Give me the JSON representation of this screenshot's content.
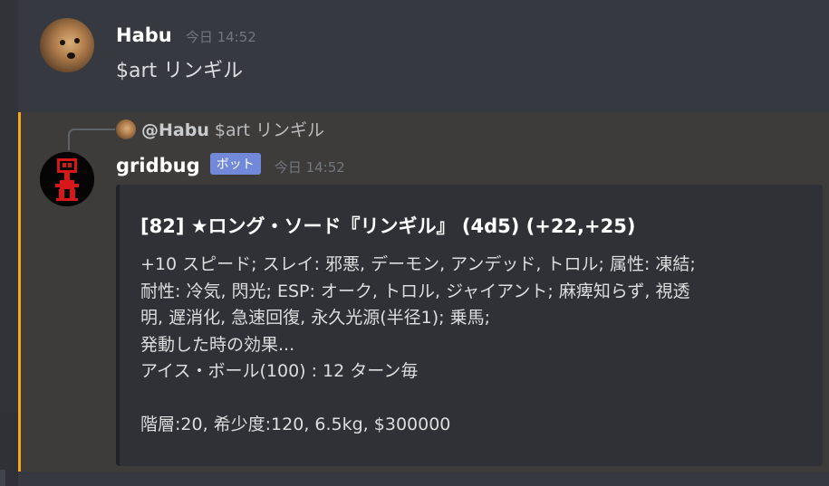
{
  "colors": {
    "background": "#36393f",
    "mention_highlight": "#3e3c3a",
    "mention_bar": "#faa61a",
    "embed_bg": "#2f3136",
    "bot_badge": "#7289da",
    "timestamp": "#72767d"
  },
  "message1": {
    "author": "Habu",
    "timestamp": "今日 14:52",
    "content": "$art リンギル",
    "avatar": "dog-avatar"
  },
  "bot_message": {
    "reply": {
      "author": "@Habu",
      "content": "$art リンギル",
      "avatar": "dog-avatar"
    },
    "author": "gridbug",
    "badge": "ボット",
    "timestamp": "今日 14:52",
    "avatar": "gridbug-avatar",
    "embed": {
      "title": "[82] ★ロング・ソード『リンギル』 (4d5) (+22,+25)",
      "lines": [
        "+10 スピード; スレイ: 邪悪, デーモン, アンデッド, トロル; 属性: 凍結;",
        "耐性: 冷気, 閃光; ESP: オーク, トロル, ジャイアント; 麻痺知らず, 視透",
        "明, 遅消化, 急速回復, 永久光源(半径1); 乗馬;",
        "発動した時の効果...",
        "アイス・ボール(100) : 12 ターン毎",
        "",
        "階層:20, 希少度:120, 6.5kg, $300000"
      ]
    }
  }
}
